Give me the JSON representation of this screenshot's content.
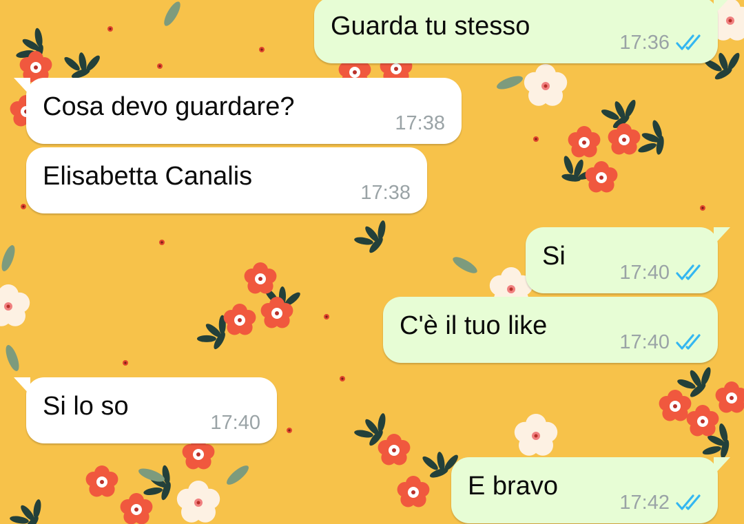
{
  "colors": {
    "wallpaper": "#f7c24a",
    "incoming_bubble": "#ffffff",
    "outgoing_bubble": "#e7fdd5",
    "read_ticks": "#34b7f1",
    "timestamp": "#9aa3a6",
    "flower_red": "#f0583e",
    "flower_white": "#fdf1e3",
    "leaf_dark": "#23403a",
    "leaf_sage": "#7d9b7d"
  },
  "messages": [
    {
      "direction": "out",
      "text": "Guarda tu stesso",
      "time": "17:36",
      "status": "read"
    },
    {
      "direction": "in",
      "text": "Cosa devo guardare?",
      "time": "17:38"
    },
    {
      "direction": "in",
      "text": "Elisabetta Canalis",
      "time": "17:38"
    },
    {
      "direction": "out",
      "text": "Si",
      "time": "17:40",
      "status": "read"
    },
    {
      "direction": "out",
      "text": "C'è il tuo like",
      "time": "17:40",
      "status": "read"
    },
    {
      "direction": "in",
      "text": "Si lo so",
      "time": "17:40"
    },
    {
      "direction": "out",
      "text": "E bravo",
      "time": "17:42",
      "status": "read"
    }
  ]
}
